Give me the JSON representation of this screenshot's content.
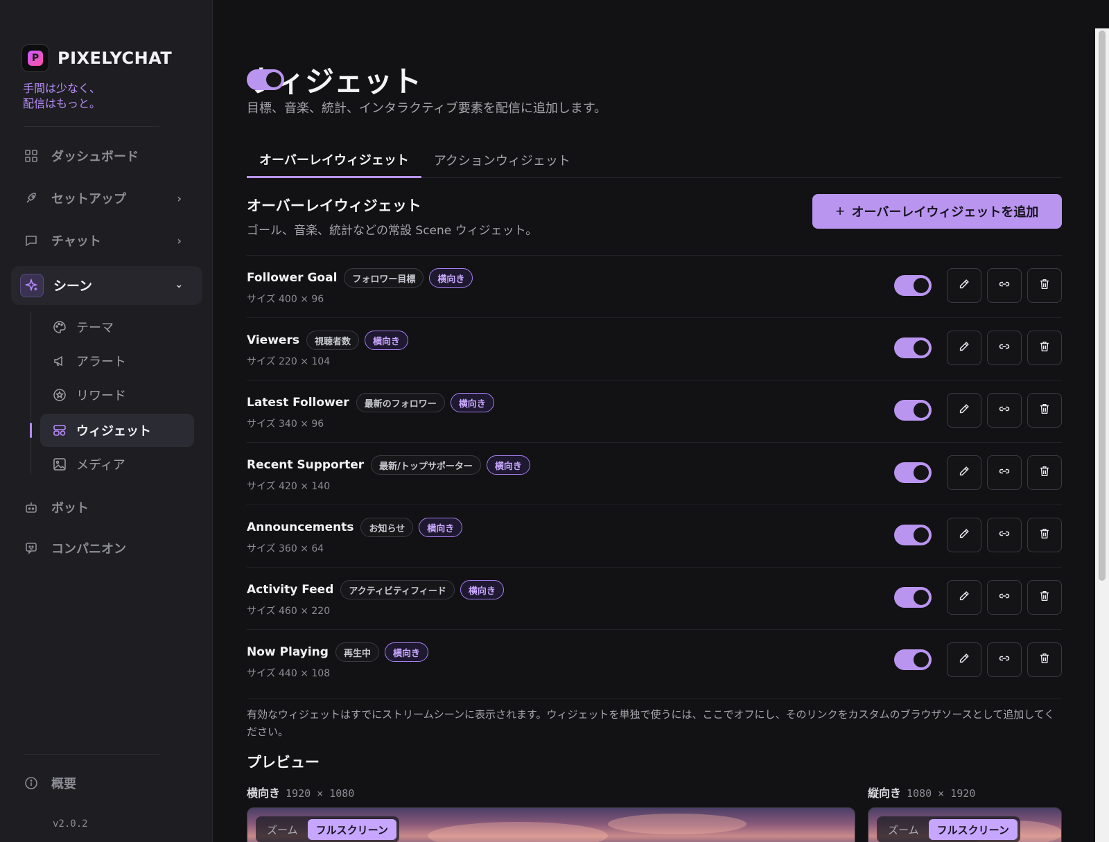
{
  "brand": {
    "name": "PIXELYCHAT",
    "tagline_line1": "手間は少なく、",
    "tagline_line2": "配信はもっと。"
  },
  "sidebar": {
    "items": [
      {
        "label": "ダッシュボード",
        "icon": "grid-icon"
      },
      {
        "label": "セットアップ",
        "icon": "rocket-icon"
      },
      {
        "label": "チャット",
        "icon": "chat-icon"
      },
      {
        "label": "シーン",
        "icon": "sparkle-icon"
      },
      {
        "label": "ボット",
        "icon": "robot-icon"
      },
      {
        "label": "コンパニオン",
        "icon": "companion-icon"
      }
    ],
    "sub_items": [
      {
        "label": "テーマ",
        "icon": "palette-icon"
      },
      {
        "label": "アラート",
        "icon": "megaphone-icon"
      },
      {
        "label": "リワード",
        "icon": "star-circle-icon"
      },
      {
        "label": "ウィジェット",
        "icon": "widget-icon"
      },
      {
        "label": "メディア",
        "icon": "image-icon"
      }
    ],
    "about_label": "概要",
    "version": "v2.0.2"
  },
  "page": {
    "title": "ウィジェット",
    "subtitle": "目標、音楽、統計、インタラクティブ要素を配信に追加します。",
    "master_enabled": true
  },
  "tabs": [
    {
      "label": "オーバーレイウィジェット",
      "active": true
    },
    {
      "label": "アクションウィジェット",
      "active": false
    }
  ],
  "section": {
    "title": "オーバーレイウィジェット",
    "subtitle": "ゴール、音楽、統計などの常設 Scene ウィジェット。",
    "add_button": "オーバーレイウィジェットを追加"
  },
  "widgets": [
    {
      "name": "Follower Goal",
      "tag": "フォロワー目標",
      "orientation": "横向き",
      "size": "サイズ 400 × 96",
      "enabled": true
    },
    {
      "name": "Viewers",
      "tag": "視聴者数",
      "orientation": "横向き",
      "size": "サイズ 220 × 104",
      "enabled": true
    },
    {
      "name": "Latest Follower",
      "tag": "最新のフォロワー",
      "orientation": "横向き",
      "size": "サイズ 340 × 96",
      "enabled": true
    },
    {
      "name": "Recent Supporter",
      "tag": "最新/トップサポーター",
      "orientation": "横向き",
      "size": "サイズ 420 × 140",
      "enabled": true
    },
    {
      "name": "Announcements",
      "tag": "お知らせ",
      "orientation": "横向き",
      "size": "サイズ 360 × 64",
      "enabled": true
    },
    {
      "name": "Activity Feed",
      "tag": "アクティビティフィード",
      "orientation": "横向き",
      "size": "サイズ 460 × 220",
      "enabled": true
    },
    {
      "name": "Now Playing",
      "tag": "再生中",
      "orientation": "横向き",
      "size": "サイズ 440 × 108",
      "enabled": true
    }
  ],
  "note": "有効なウィジェットはすでにストリームシーンに表示されます。ウィジェットを単独で使うには、ここでオフにし、そのリンクをカスタムのブラウザソースとして追加してください。",
  "preview": {
    "title": "プレビュー",
    "landscape": {
      "label": "横向き",
      "dims": "1920 × 1080"
    },
    "portrait": {
      "label": "縦向き",
      "dims": "1080 × 1920"
    },
    "zoom_label": "ズーム",
    "fullscreen_label": "フルスクリーン"
  },
  "colors": {
    "accent": "#b995f0",
    "background": "#121214",
    "sidebar": "#1e1e22"
  }
}
